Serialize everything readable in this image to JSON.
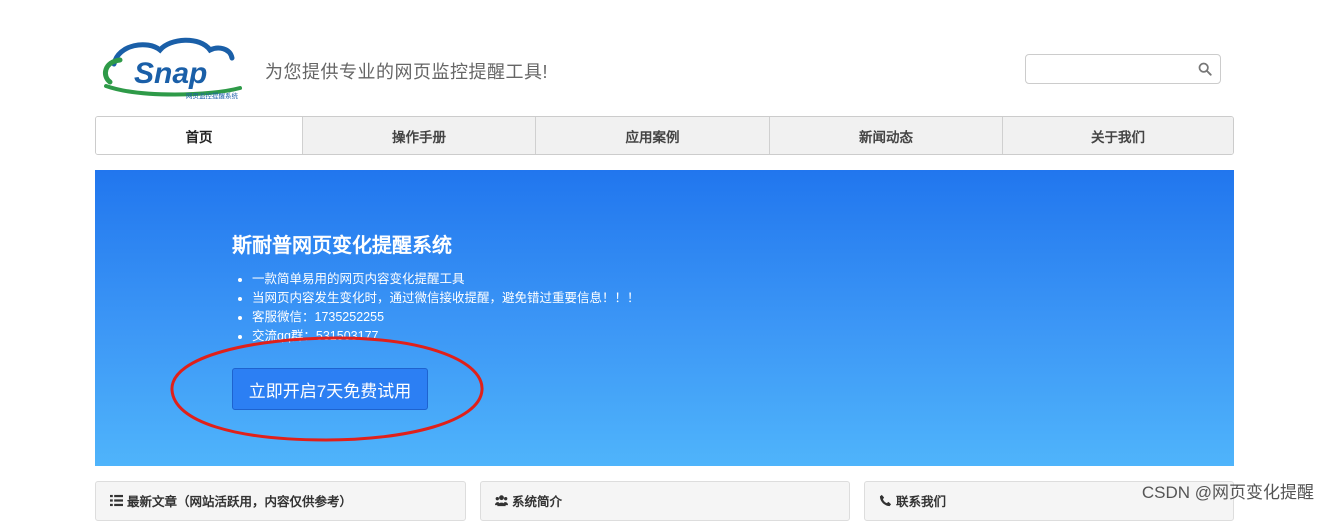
{
  "header": {
    "logo_text": "Snap",
    "logo_subtext": "网页监控提醒系统",
    "slogan": "为您提供专业的网页监控提醒工具!",
    "search": {
      "placeholder": "",
      "value": ""
    }
  },
  "nav": {
    "items": [
      {
        "label": "首页"
      },
      {
        "label": "操作手册"
      },
      {
        "label": "应用案例"
      },
      {
        "label": "新闻动态"
      },
      {
        "label": "关于我们"
      }
    ]
  },
  "hero": {
    "title": "斯耐普网页变化提醒系统",
    "bullets": [
      "一款简单易用的网页内容变化提醒工具",
      "当网页内容发生变化时，通过微信接收提醒，避免错过重要信息！！！",
      "客服微信：1735252255",
      "交流qq群：531503177"
    ],
    "cta_label": "立即开启7天免费试用"
  },
  "panels": [
    {
      "title": "最新文章（网站活跃用，内容仅供参考）",
      "icon": "list-icon"
    },
    {
      "title": "系统简介",
      "icon": "users-icon"
    },
    {
      "title": "联系我们",
      "icon": "phone-icon"
    }
  ],
  "watermark": "CSDN @网页变化提醒",
  "colors": {
    "hero_top": "#2176ee",
    "hero_bottom": "#4fb4fb",
    "cta": "#2c7ff3",
    "annotation": "#e0201a",
    "logo_blue": "#1a5fa8",
    "logo_green": "#2e9a48"
  }
}
